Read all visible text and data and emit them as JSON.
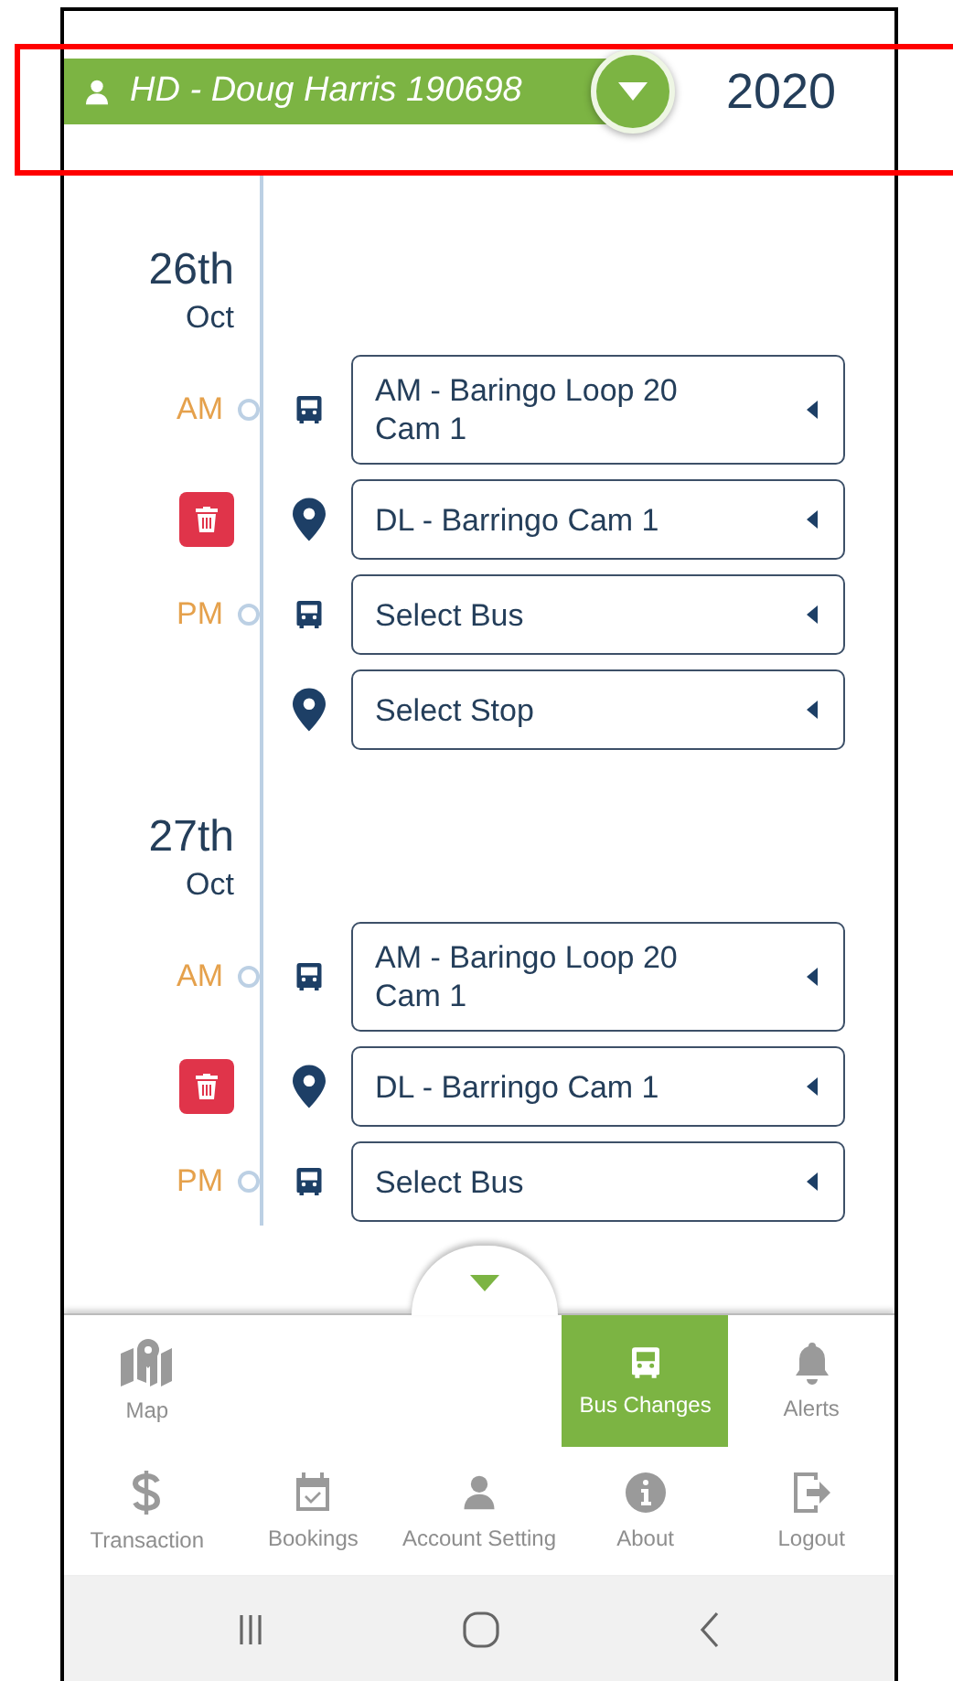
{
  "header": {
    "user": "HD - Doug Harris 190698",
    "year": "2020"
  },
  "days": [
    {
      "day": "26th",
      "month": "Oct",
      "rows": [
        {
          "kind": "bus",
          "period": "AM",
          "deletable": false,
          "value": "AM - Baringo Loop 20 Cam 1"
        },
        {
          "kind": "stop",
          "deletable": true,
          "value": "DL - Barringo Cam 1"
        },
        {
          "kind": "bus",
          "period": "PM",
          "deletable": false,
          "value": "Select Bus"
        },
        {
          "kind": "stop",
          "deletable": false,
          "value": "Select Stop"
        }
      ]
    },
    {
      "day": "27th",
      "month": "Oct",
      "rows": [
        {
          "kind": "bus",
          "period": "AM",
          "deletable": false,
          "value": "AM - Baringo Loop 20 Cam 1"
        },
        {
          "kind": "stop",
          "deletable": true,
          "value": "DL - Barringo Cam 1"
        },
        {
          "kind": "bus",
          "period": "PM",
          "deletable": false,
          "value": "Select Bus"
        }
      ]
    }
  ],
  "nav": {
    "top_left": [
      {
        "kind": "map",
        "label": "Map",
        "selected": false
      }
    ],
    "top_right": [
      {
        "kind": "bus",
        "label": "Bus Changes",
        "selected": true
      },
      {
        "kind": "bell",
        "label": "Alerts",
        "selected": false
      }
    ],
    "bottom": [
      {
        "kind": "dollar",
        "label": "Transaction",
        "selected": false
      },
      {
        "kind": "calendar",
        "label": "Bookings",
        "selected": false
      },
      {
        "kind": "person",
        "label": "Account Setting",
        "selected": false
      },
      {
        "kind": "info",
        "label": "About",
        "selected": false
      },
      {
        "kind": "logout",
        "label": "Logout",
        "selected": false
      }
    ]
  }
}
